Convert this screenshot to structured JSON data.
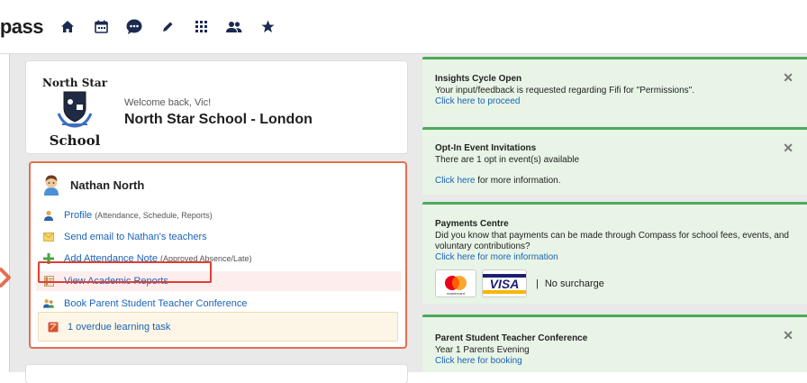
{
  "topbar": {
    "brand": "pass",
    "nav_icons": [
      "home-icon",
      "calendar-icon",
      "chat-icon",
      "pencil-icon",
      "grid-icon",
      "people-icon",
      "star-icon"
    ]
  },
  "school": {
    "logo_top": "North Star",
    "logo_bottom": "School",
    "welcome": "Welcome back, Vic!",
    "name": "North Star School - London"
  },
  "student": {
    "name": "Nathan North",
    "menu": [
      {
        "label": "Profile",
        "sub": "(Attendance, Schedule, Reports)",
        "icon": "profile-icon"
      },
      {
        "label": "Send email to Nathan's teachers",
        "sub": "",
        "icon": "envelope-icon"
      },
      {
        "label": "Add Attendance Note",
        "sub": "(Approved Absence/Late)",
        "icon": "plus-icon"
      },
      {
        "label": "View Academic Reports",
        "sub": "",
        "icon": "report-icon"
      },
      {
        "label": "Book Parent Student Teacher Conference",
        "sub": "",
        "icon": "conference-icon"
      }
    ],
    "overdue": "1 overdue learning task"
  },
  "notices": {
    "insights": {
      "title": "Insights Cycle Open",
      "body": "Your input/feedback is requested regarding Fifi for \"Permissions\".",
      "link": "Click here to proceed",
      "close": "✕"
    },
    "optin": {
      "title": "Opt-In Event Invitations",
      "body": "There are 1 opt in event(s) available",
      "link": "Click here",
      "link_suffix": " for more information.",
      "close": "✕"
    },
    "payments": {
      "title": "Payments Centre",
      "body": "Did you know that payments can be made through Compass for school fees, events, and voluntary contributions?",
      "link": "Click here for more information",
      "mastercard_label": "mastercard",
      "visa_label": "VISA",
      "separator": "|",
      "no_surcharge": "No surcharge"
    },
    "conference": {
      "title": "Parent Student Teacher Conference",
      "body": "Year 1 Parents Evening",
      "link": "Click here for booking",
      "close": "✕"
    }
  },
  "colors": {
    "accent_orange": "#e46f53",
    "highlight_red": "#e23d34",
    "notice_green": "#4caa5a",
    "link_blue": "#1a63b8"
  }
}
